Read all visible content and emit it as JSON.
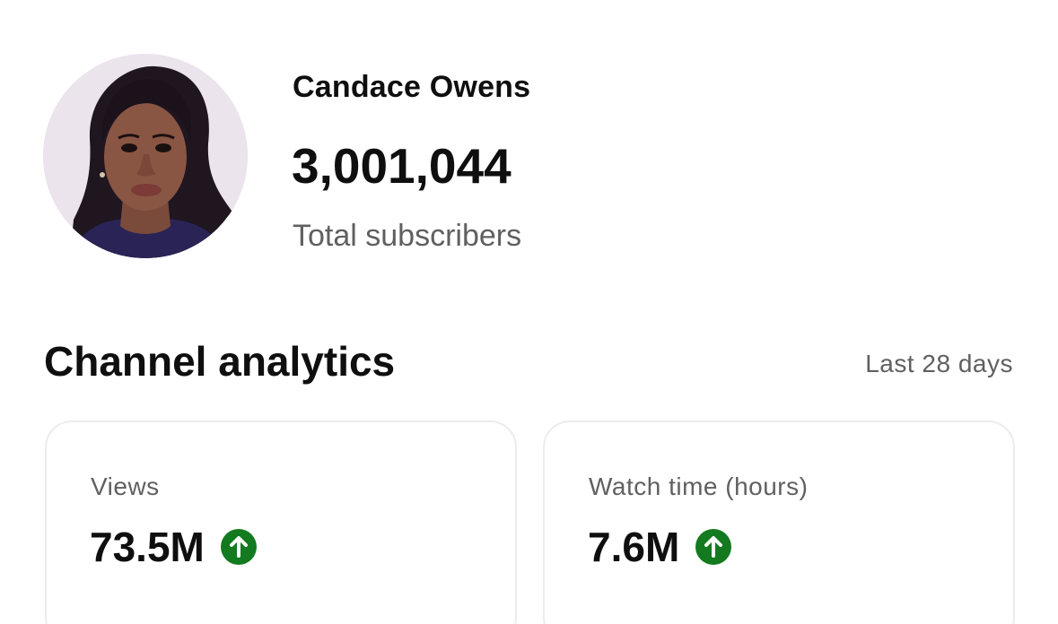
{
  "channel": {
    "name": "Candace Owens",
    "subscriber_count": "3,001,044",
    "subscriber_label": "Total subscribers"
  },
  "analytics": {
    "title": "Channel analytics",
    "period": "Last 28 days",
    "metrics": [
      {
        "label": "Views",
        "value": "73.5M",
        "trend": "up",
        "trend_icon": "arrow-up-circle-icon"
      },
      {
        "label": "Watch time (hours)",
        "value": "7.6M",
        "trend": "up",
        "trend_icon": "arrow-up-circle-icon"
      }
    ]
  },
  "colors": {
    "trend_up": "#137a1f",
    "secondary_text": "#606060",
    "primary_text": "#0f0f0f",
    "card_border": "#ececec"
  }
}
